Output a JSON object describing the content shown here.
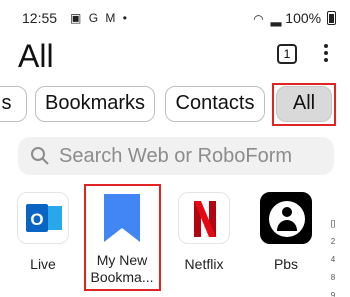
{
  "status_bar": {
    "time": "12:55",
    "left_icons": [
      "image-icon",
      "g-icon",
      "gmail-icon",
      "dot-icon"
    ],
    "battery": "100%"
  },
  "header": {
    "title": "All",
    "tab_count": "1"
  },
  "filters": {
    "partial_label": "s",
    "items": [
      "Bookmarks",
      "Contacts",
      "All"
    ],
    "selected": "All"
  },
  "search": {
    "placeholder": "Search Web or RoboForm"
  },
  "tiles": [
    {
      "label": "Live",
      "icon": "outlook-icon"
    },
    {
      "label_line1": "My New",
      "label_line2": "Bookma...",
      "icon": "bookmark-icon"
    },
    {
      "label": "Netflix",
      "icon": "netflix-icon"
    },
    {
      "label": "Pbs",
      "icon": "pbs-icon"
    }
  ],
  "side_index": [
    "[]",
    "2",
    "4",
    "8",
    "9"
  ],
  "colors": {
    "highlight": "#e02424",
    "selected_chip": "#d9d9d9",
    "bookmark_blue": "#4285f4",
    "netflix_red": "#e50914",
    "outlook_blue": "#0a64c4"
  }
}
